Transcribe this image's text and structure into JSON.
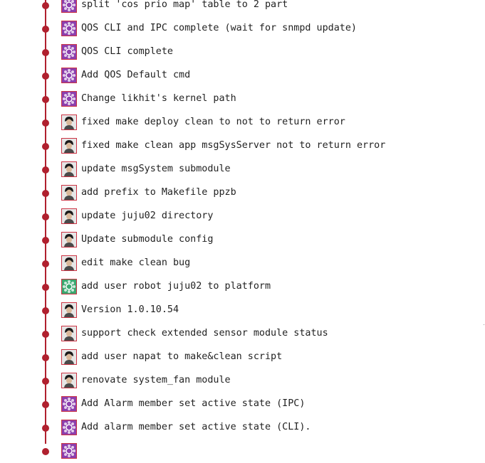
{
  "commits": [
    {
      "message": "split 'cos prio map' table to 2 part",
      "avatar": "purple-pattern-avatar",
      "avatar_color": "#8c3fae"
    },
    {
      "message": "QOS CLI and IPC complete (wait for snmpd update)",
      "avatar": "purple-pattern-avatar",
      "avatar_color": "#8c3fae"
    },
    {
      "message": "QOS CLI complete",
      "avatar": "purple-pattern-avatar",
      "avatar_color": "#8c3fae"
    },
    {
      "message": "Add QOS Default cmd",
      "avatar": "purple-pattern-avatar",
      "avatar_color": "#8c3fae"
    },
    {
      "message": "Change likhit's kernel path",
      "avatar": "purple-pattern-avatar",
      "avatar_color": "#8c3fae"
    },
    {
      "message": "fixed make deploy clean to not to return error",
      "avatar": "user-photo-avatar",
      "avatar_color": "#4a4a4a"
    },
    {
      "message": "fixed make clean app msgSysServer not to return error",
      "avatar": "user-photo-avatar",
      "avatar_color": "#4a4a4a"
    },
    {
      "message": "update msgSystem submodule",
      "avatar": "user-photo-avatar",
      "avatar_color": "#4a4a4a"
    },
    {
      "message": "add prefix to Makefile ppzb",
      "avatar": "user-photo-avatar",
      "avatar_color": "#4a4a4a"
    },
    {
      "message": "update juju02 directory",
      "avatar": "user-photo-avatar",
      "avatar_color": "#4a4a4a"
    },
    {
      "message": "Update submodule config",
      "avatar": "user-photo-avatar",
      "avatar_color": "#4a4a4a"
    },
    {
      "message": "edit make clean bug",
      "avatar": "user-photo-avatar",
      "avatar_color": "#4a4a4a"
    },
    {
      "message": "add user robot juju02 to platform",
      "avatar": "green-pattern-avatar",
      "avatar_color": "#3aa870"
    },
    {
      "message": "Version 1.0.10.54",
      "avatar": "user-photo-avatar",
      "avatar_color": "#4a4a4a"
    },
    {
      "message": "support check extended sensor module status",
      "avatar": "user-photo-avatar",
      "avatar_color": "#4a4a4a"
    },
    {
      "message": "add user napat to make&clean script",
      "avatar": "user-photo-avatar",
      "avatar_color": "#4a4a4a"
    },
    {
      "message": "renovate system_fan module",
      "avatar": "user-photo-avatar",
      "avatar_color": "#4a4a4a"
    },
    {
      "message": "Add Alarm member set active state (IPC)",
      "avatar": "purple-pattern-avatar",
      "avatar_color": "#8c3fae"
    },
    {
      "message": "Add alarm member set active state (CLI).",
      "avatar": "purple-pattern-avatar",
      "avatar_color": "#8c3fae"
    },
    {
      "message": "",
      "avatar": "purple-pattern-avatar",
      "avatar_color": "#8c3fae"
    }
  ],
  "colors": {
    "graph_line": "#b0202e",
    "avatar_border": "#cc3344",
    "text": "#222222"
  }
}
